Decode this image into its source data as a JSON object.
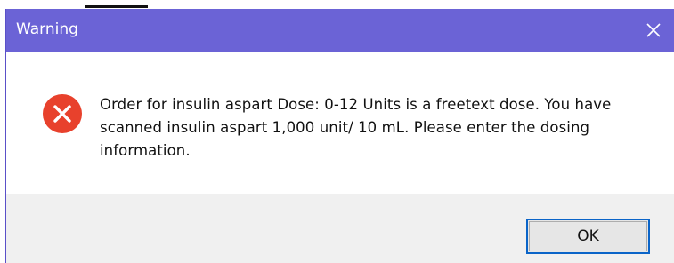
{
  "dialog": {
    "title": "Warning",
    "close_icon": "close-icon",
    "status_icon": "error-icon",
    "message": "Order for insulin aspart Dose: 0-12 Units is a freetext dose. You have scanned insulin aspart 1,000 unit/ 10 mL. Please enter the dosing information.",
    "ok_label": "OK"
  },
  "colors": {
    "titlebar": "#6b63d6",
    "error_icon": "#e8412c",
    "footer": "#f0f0f0",
    "ok_border": "#0a64c8"
  }
}
